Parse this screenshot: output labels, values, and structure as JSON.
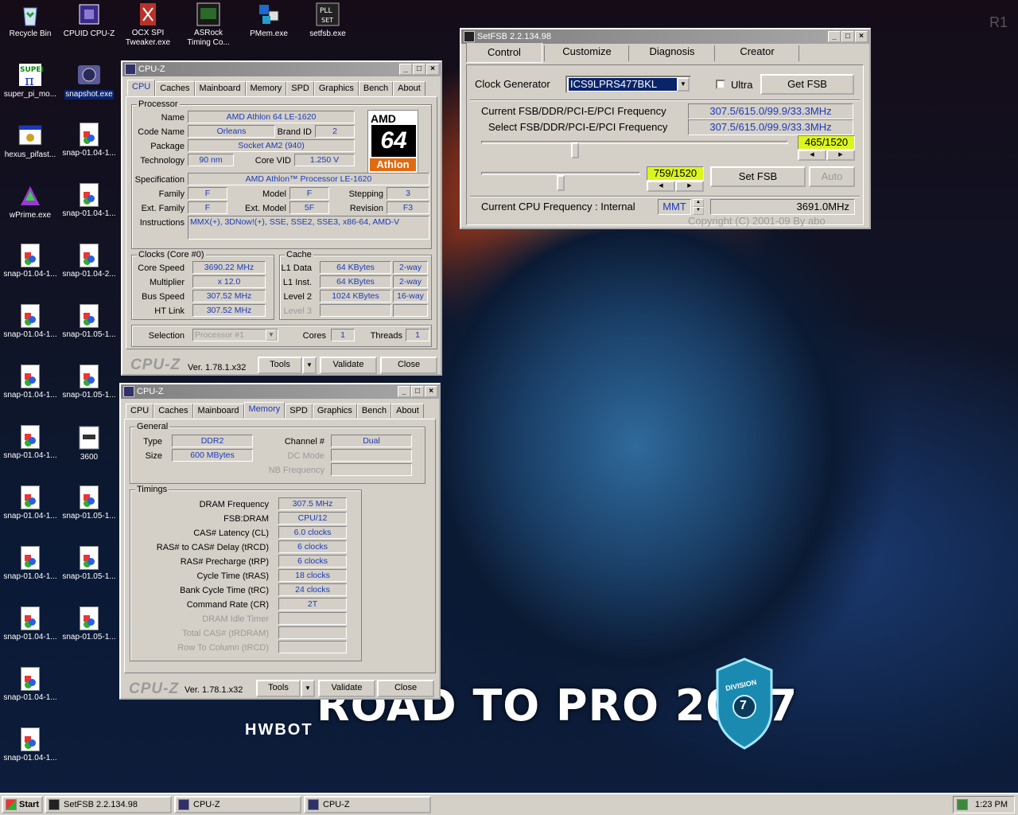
{
  "desktop": {
    "icons": [
      {
        "label": "Recycle Bin"
      },
      {
        "label": "CPUID CPU-Z"
      },
      {
        "label": "OCX SPI Tweaker.exe"
      },
      {
        "label": "ASRock Timing Co..."
      },
      {
        "label": "PMem.exe"
      },
      {
        "label": "setfsb.exe"
      },
      {
        "label": "super_pi_mo..."
      },
      {
        "label": "snapshot.exe"
      },
      {
        "label": "hexus_pifast..."
      },
      {
        "label": "snap-01.04-1..."
      },
      {
        "label": "wPrime.exe"
      },
      {
        "label": "snap-01.04-1..."
      },
      {
        "label": "snap-01.04-1..."
      },
      {
        "label": "snap-01.04-2..."
      },
      {
        "label": "snap-01.04-1..."
      },
      {
        "label": "snap-01.05-1..."
      },
      {
        "label": "snap-01.04-1..."
      },
      {
        "label": "snap-01.05-1..."
      },
      {
        "label": "snap-01.04-1..."
      },
      {
        "label": "3600"
      },
      {
        "label": "snap-01.04-1..."
      },
      {
        "label": "snap-01.05-1..."
      },
      {
        "label": "snap-01.04-1..."
      },
      {
        "label": "snap-01.05-1..."
      },
      {
        "label": "snap-01.04-1..."
      },
      {
        "label": "snap-01.05-1..."
      },
      {
        "label": "snap-01.04-1..."
      },
      {
        "label": "snap-01.04-1..."
      }
    ],
    "corner_text": "R1",
    "wallpaper": {
      "headline": "ROAD TO PRO 2017",
      "brand": "HWBOT",
      "badge_top": "DIVISION",
      "badge_num": "7"
    }
  },
  "cpuz1": {
    "title": "CPU-Z",
    "tabs": [
      "CPU",
      "Caches",
      "Mainboard",
      "Memory",
      "SPD",
      "Graphics",
      "Bench",
      "About"
    ],
    "active_tab": "CPU",
    "processor": {
      "group": "Processor",
      "name_label": "Name",
      "name": "AMD Athlon 64 LE-1620",
      "codename_label": "Code Name",
      "codename": "Orleans",
      "brandid_label": "Brand ID",
      "brandid": "2",
      "package_label": "Package",
      "package": "Socket AM2 (940)",
      "tech_label": "Technology",
      "tech": "90 nm",
      "vid_label": "Core VID",
      "vid": "1.250 V",
      "spec_label": "Specification",
      "spec": "AMD Athlon™ Processor LE-1620",
      "family_label": "Family",
      "family": "F",
      "model_label": "Model",
      "model": "F",
      "stepping_label": "Stepping",
      "stepping": "3",
      "extfamily_label": "Ext. Family",
      "extfamily": "F",
      "extmodel_label": "Ext. Model",
      "extmodel": "5F",
      "revision_label": "Revision",
      "revision": "F3",
      "instr_label": "Instructions",
      "instr": "MMX(+), 3DNow!(+), SSE, SSE2, SSE3, x86-64, AMD-V",
      "logo_top": "AMD",
      "logo_mid": "64",
      "logo_bottom": "Athlon"
    },
    "clocks": {
      "group": "Clocks (Core #0)",
      "core_label": "Core Speed",
      "core": "3690.22 MHz",
      "mult_label": "Multiplier",
      "mult": "x 12.0",
      "bus_label": "Bus Speed",
      "bus": "307.52 MHz",
      "ht_label": "HT Link",
      "ht": "307.52 MHz"
    },
    "cache": {
      "group": "Cache",
      "l1d_label": "L1 Data",
      "l1d": "64 KBytes",
      "l1d_way": "2-way",
      "l1i_label": "L1 Inst.",
      "l1i": "64 KBytes",
      "l1i_way": "2-way",
      "l2_label": "Level 2",
      "l2": "1024 KBytes",
      "l2_way": "16-way",
      "l3_label": "Level 3"
    },
    "selection_label": "Selection",
    "selection": "Processor #1",
    "cores_label": "Cores",
    "cores": "1",
    "threads_label": "Threads",
    "threads": "1",
    "logo": "CPU-Z",
    "version": "Ver. 1.78.1.x32",
    "tools": "Tools",
    "validate": "Validate",
    "close": "Close"
  },
  "cpuz2": {
    "title": "CPU-Z",
    "tabs": [
      "CPU",
      "Caches",
      "Mainboard",
      "Memory",
      "SPD",
      "Graphics",
      "Bench",
      "About"
    ],
    "active_tab": "Memory",
    "general": {
      "group": "General",
      "type_label": "Type",
      "type": "DDR2",
      "size_label": "Size",
      "size": "600 MBytes",
      "channel_label": "Channel #",
      "channel": "Dual",
      "dc_label": "DC Mode",
      "nb_label": "NB Frequency"
    },
    "timings": {
      "group": "Timings",
      "rows": [
        {
          "label": "DRAM Frequency",
          "value": "307.5 MHz"
        },
        {
          "label": "FSB:DRAM",
          "value": "CPU/12"
        },
        {
          "label": "CAS# Latency (CL)",
          "value": "6.0 clocks"
        },
        {
          "label": "RAS# to CAS# Delay (tRCD)",
          "value": "6 clocks"
        },
        {
          "label": "RAS# Precharge (tRP)",
          "value": "6 clocks"
        },
        {
          "label": "Cycle Time (tRAS)",
          "value": "18 clocks"
        },
        {
          "label": "Bank Cycle Time (tRC)",
          "value": "24 clocks"
        },
        {
          "label": "Command Rate (CR)",
          "value": "2T"
        },
        {
          "label": "DRAM Idle Timer",
          "value": ""
        },
        {
          "label": "Total CAS# (tRDRAM)",
          "value": ""
        },
        {
          "label": "Row To Column (tRCD)",
          "value": ""
        }
      ]
    },
    "logo": "CPU-Z",
    "version": "Ver. 1.78.1.x32",
    "tools": "Tools",
    "validate": "Validate",
    "close": "Close"
  },
  "setfsb": {
    "title": "SetFSB 2.2.134.98",
    "tabs": [
      "Control",
      "Customize",
      "Diagnosis",
      "Creator"
    ],
    "clockgen_label": "Clock Generator",
    "clockgen": "ICS9LPRS477BKL",
    "ultra_label": "Ultra",
    "getfsb": "Get FSB",
    "current_label": "Current FSB/DDR/PCI-E/PCI Frequency",
    "current": "307.5/615.0/99.9/33.3MHz",
    "select_label": "Select FSB/DDR/PCI-E/PCI Frequency",
    "select": "307.5/615.0/99.9/33.3MHz",
    "slider1": "465/1520",
    "slider2": "759/1520",
    "slider1_pos": 0.306,
    "slider2_pos": 0.499,
    "setfsb": "Set FSB",
    "auto": "Auto",
    "cpufreq_label": "Current CPU Frequency : Internal",
    "mmt": "MMT",
    "cpufreq": "3691.0MHz",
    "copyright": "Copyright (C) 2001-09 By abo"
  },
  "taskbar": {
    "start": "Start",
    "items": [
      "SetFSB 2.2.134.98",
      "CPU-Z",
      "CPU-Z"
    ],
    "clock": "1:23 PM"
  }
}
